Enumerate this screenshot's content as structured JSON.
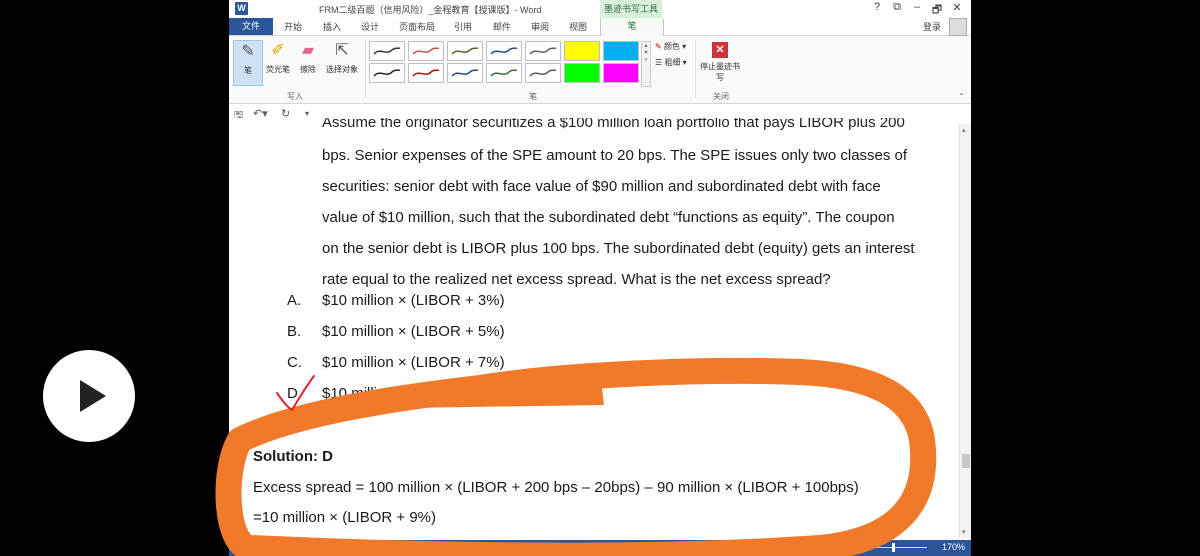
{
  "window": {
    "title": "FRM二级百题（信用风险）_金程教育【授课版】- Word",
    "app_icon": "W",
    "contextual_tab_group": "墨迹书写工具",
    "controls": [
      "?",
      "⧉",
      "–",
      "🗗",
      "✕"
    ],
    "login": "登录"
  },
  "tabs": [
    "开始",
    "插入",
    "设计",
    "页面布局",
    "引用",
    "邮件",
    "审阅",
    "视图"
  ],
  "file_tab": "文件",
  "active_tab": "笔",
  "ribbon": {
    "write_group": {
      "label": "写入",
      "buttons": [
        {
          "label": "笔",
          "icon": "pen-icon"
        },
        {
          "label": "荧光笔",
          "icon": "highlighter-icon"
        },
        {
          "label": "擦除",
          "icon": "eraser-icon"
        },
        {
          "label": "选择对象",
          "icon": "select-cursor-icon"
        }
      ]
    },
    "pens_group": {
      "label": "笔",
      "color_option": "颜色",
      "thickness_option": "粗细",
      "swatches": [
        "#333333",
        "#c0504d",
        "#4f6228",
        "#1f497d",
        "#5a5a5a",
        "#ffff00",
        "#00b0f0",
        "#222222",
        "#c00000",
        "#1f497d",
        "#2e6b2e",
        "#555555",
        "#00ff00",
        "#ff00ff"
      ]
    },
    "close_group": {
      "label": "关闭",
      "stop_button": "停止墨迹书写"
    }
  },
  "document": {
    "cut_line": "Assume the originator securitizes a $100 million loan portfolio that pays LIBOR plus 200",
    "question_lines": [
      "bps. Senior expenses of the SPE amount to 20 bps. The SPE issues only two classes of",
      "securities: senior debt with face value of $90 million and subordinated debt with face",
      "value of $10 million, such that the subordinated debt “functions as equity”. The coupon",
      "on the senior debt is LIBOR plus 100 bps. The subordinated debt (equity) gets an interest",
      "rate equal to the realized net excess spread. What is the net excess spread?"
    ],
    "options": [
      {
        "letter": "A.",
        "text": "$10 million × (LIBOR + 3%)"
      },
      {
        "letter": "B.",
        "text": "$10 million × (LIBOR + 5%)"
      },
      {
        "letter": "C.",
        "text": "$10 million × (LIBOR + 7%)"
      },
      {
        "letter": "D.",
        "text": "$10 million × (LIBOR + 9%)"
      }
    ],
    "solution": "Solution: D",
    "equation_line1": "Excess spread = 100 million × (LIBOR + 200 bps – 20bps) – 90 million × (LIBOR + 100bps)",
    "equation_line2": "=10 million × (LIBOR + 9%)"
  },
  "status_bar": {
    "zoom": "170%"
  },
  "annotations": {
    "ink_color": "#f07a2a",
    "checkmark_color": "#d9262c"
  }
}
